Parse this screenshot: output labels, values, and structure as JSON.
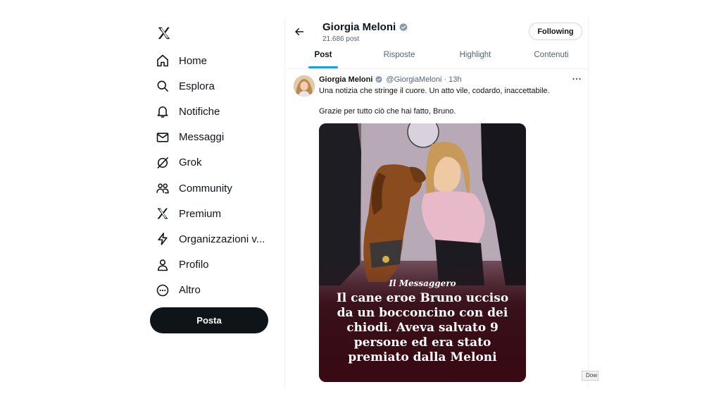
{
  "sidebar": {
    "logo_icon": "x-logo-icon",
    "items": [
      {
        "label": "Home",
        "icon": "home-icon"
      },
      {
        "label": "Esplora",
        "icon": "search-icon"
      },
      {
        "label": "Notifiche",
        "icon": "bell-icon"
      },
      {
        "label": "Messaggi",
        "icon": "envelope-icon"
      },
      {
        "label": "Grok",
        "icon": "grok-icon"
      },
      {
        "label": "Community",
        "icon": "people-icon"
      },
      {
        "label": "Premium",
        "icon": "x-logo-icon"
      },
      {
        "label": "Organizzazioni v...",
        "icon": "lightning-icon"
      },
      {
        "label": "Profilo",
        "icon": "person-icon"
      },
      {
        "label": "Altro",
        "icon": "more-circle-icon"
      }
    ],
    "post_button": "Posta"
  },
  "profile_header": {
    "name": "Giorgia Meloni",
    "post_count": "21.686 post",
    "follow_button": "Following"
  },
  "tabs": [
    {
      "label": "Post",
      "active": true
    },
    {
      "label": "Risposte",
      "active": false
    },
    {
      "label": "Highlight",
      "active": false
    },
    {
      "label": "Contenuti",
      "active": false
    }
  ],
  "tweet": {
    "author": "Giorgia Meloni",
    "handle": "@GiorgiaMeloni",
    "separator": "·",
    "time": "13h",
    "text_line1": "Una notizia che stringe il cuore. Un atto vile, codardo, inaccettabile.",
    "text_line2": "Grazie per tutto ciò che hai fatto, Bruno.",
    "media": {
      "masthead": "Il Messaggero",
      "headline": "Il cane eroe Bruno ucciso da un bocconcino con dei chiodi. Aveva salvato 9 persone ed era stato premiato dalla Meloni"
    }
  },
  "download_tag": "Dow",
  "colors": {
    "accent": "#1d9bf0",
    "text": "#0f1419",
    "secondary_text": "#536471",
    "post_button_bg": "#0f1419",
    "verified_badge": "#829aab"
  }
}
